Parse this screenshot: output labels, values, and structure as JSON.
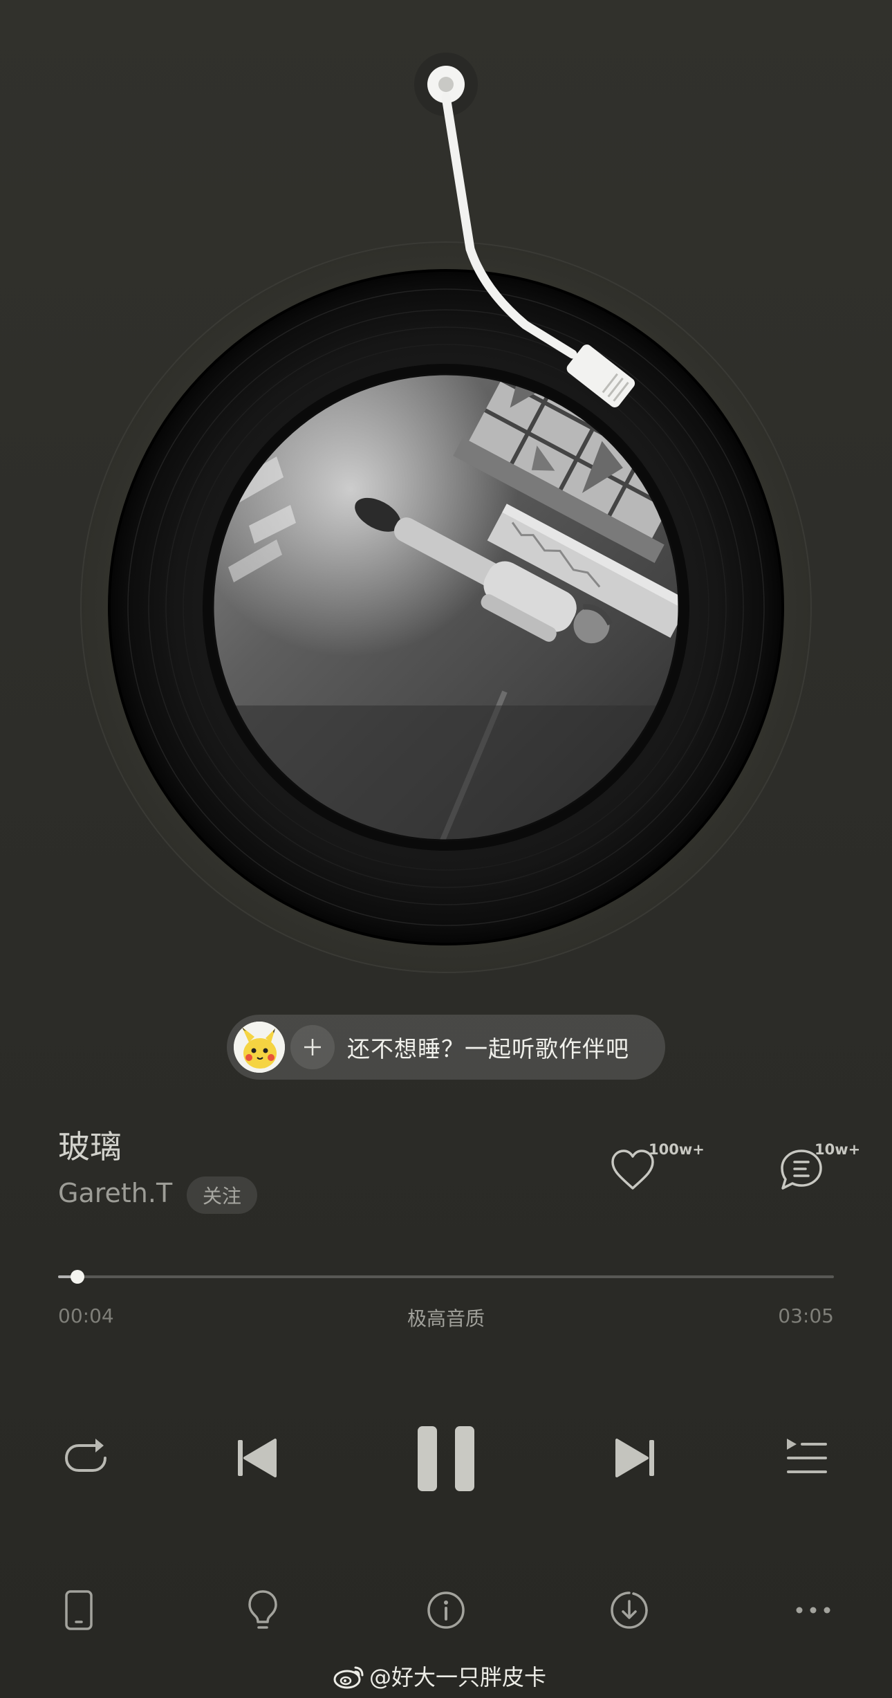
{
  "player": {
    "song_title": "玻璃",
    "artist": "Gareth.T",
    "follow_label": "关注",
    "like_count": "100w+",
    "comment_count": "10w+",
    "current_time": "00:04",
    "total_time": "03:05",
    "quality_label": "极高音质",
    "progress_fraction": 0.025,
    "is_playing": true
  },
  "bubble": {
    "text": "还不想睡？一起听歌作伴吧",
    "plus_symbol": "+"
  },
  "controls": {
    "icons": [
      "repeat-icon",
      "previous-icon",
      "pause-icon",
      "next-icon",
      "playlist-icon"
    ]
  },
  "bottom_bar": {
    "icons": [
      "device-icon",
      "lightbulb-icon",
      "info-icon",
      "download-icon",
      "more-icon"
    ]
  },
  "watermark": {
    "text": "@好大一只胖皮卡"
  },
  "colors": {
    "background": "#2d2d29",
    "vinyl": "#111111",
    "tonearm": "#f2f2f0",
    "accent_text": "#d2d2cc"
  }
}
